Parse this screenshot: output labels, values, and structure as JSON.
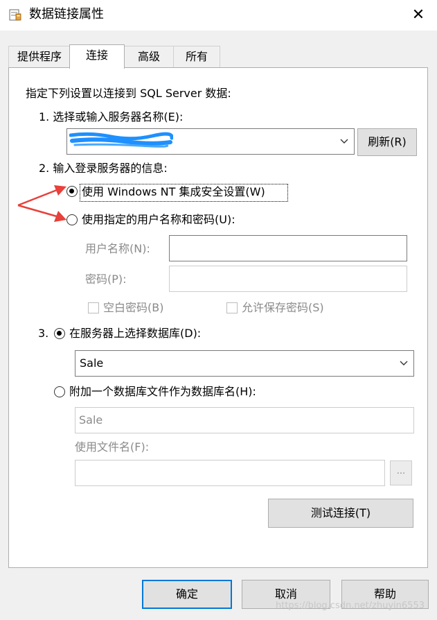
{
  "window": {
    "title": "数据链接属性",
    "close_glyph": "✕"
  },
  "tabs": [
    {
      "label": "提供程序"
    },
    {
      "label": "连接"
    },
    {
      "label": "高级"
    },
    {
      "label": "所有"
    }
  ],
  "connection": {
    "intro": "指定下列设置以连接到 SQL Server 数据:",
    "step1_label": "1. 选择或输入服务器名称(E):",
    "server_value": "",
    "refresh_label": "刷新(R)",
    "step2_label": "2. 输入登录服务器的信息:",
    "auth_windows_label": "使用 Windows NT 集成安全设置(W)",
    "auth_sql_label": "使用指定的用户名称和密码(U):",
    "auth_selected": "windows",
    "username_label": "用户名称(N):",
    "username_value": "",
    "password_label": "密码(P):",
    "password_value": "",
    "blank_password_label": "空白密码(B)",
    "allow_save_label": "允许保存密码(S)",
    "step3_number": "3.",
    "db_select_label": "在服务器上选择数据库(D):",
    "db_value": "Sale",
    "attach_label": "附加一个数据库文件作为数据库名(H):",
    "attach_db_value": "Sale",
    "filename_label": "使用文件名(F):",
    "filename_value": "",
    "browse_label": "...",
    "test_button_label": "测试连接(T)"
  },
  "footer": {
    "ok_label": "确定",
    "cancel_label": "取消",
    "help_label": "帮助"
  },
  "watermark": "https://blog.csdn.net/zhuyin6553",
  "colors": {
    "annotation_arrow": "#e8403a",
    "default_button_border": "#0078d7",
    "scribble": "#1e90ff"
  }
}
